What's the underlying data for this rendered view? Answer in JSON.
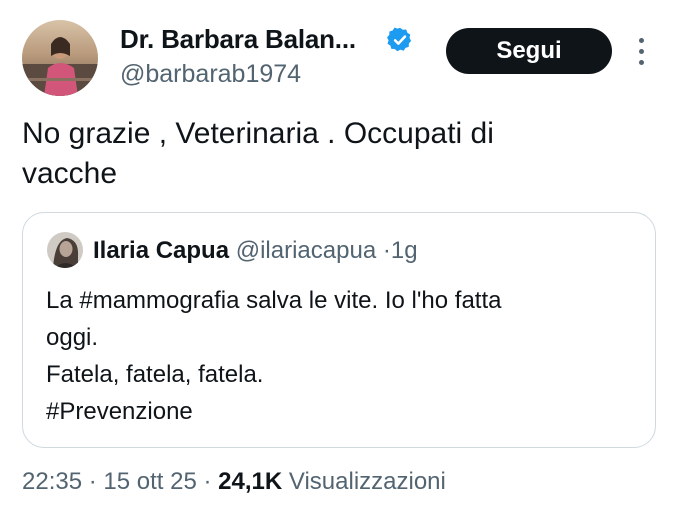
{
  "author": {
    "display_name": "Dr. Barbara Balan...",
    "handle": "@barbarab1974",
    "verified_icon": "verified-badge-icon",
    "verified_color": "#1d9bf0"
  },
  "follow_button": {
    "label": "Segui"
  },
  "more_menu_icon": "more-vertical-icon",
  "tweet": {
    "text": "No grazie , Veterinaria . Occupati di\nvacche"
  },
  "quoted_tweet": {
    "author_name": "Ilaria Capua",
    "handle": "@ilariacapua",
    "separator": "·",
    "time": "1g",
    "text": "La #mammografia salva le vite. Io l'ho fatta\noggi.\nFatela, fatela, fatela.\n#Prevenzione"
  },
  "meta": {
    "time": "22:35",
    "separator": "·",
    "date": "15 ott 25",
    "views_count": "24,1K",
    "views_label": "Visualizzazioni"
  },
  "colors": {
    "text_primary": "#0f1419",
    "text_secondary": "#536471",
    "border": "#cfd9de",
    "button_bg": "#0f1419"
  }
}
